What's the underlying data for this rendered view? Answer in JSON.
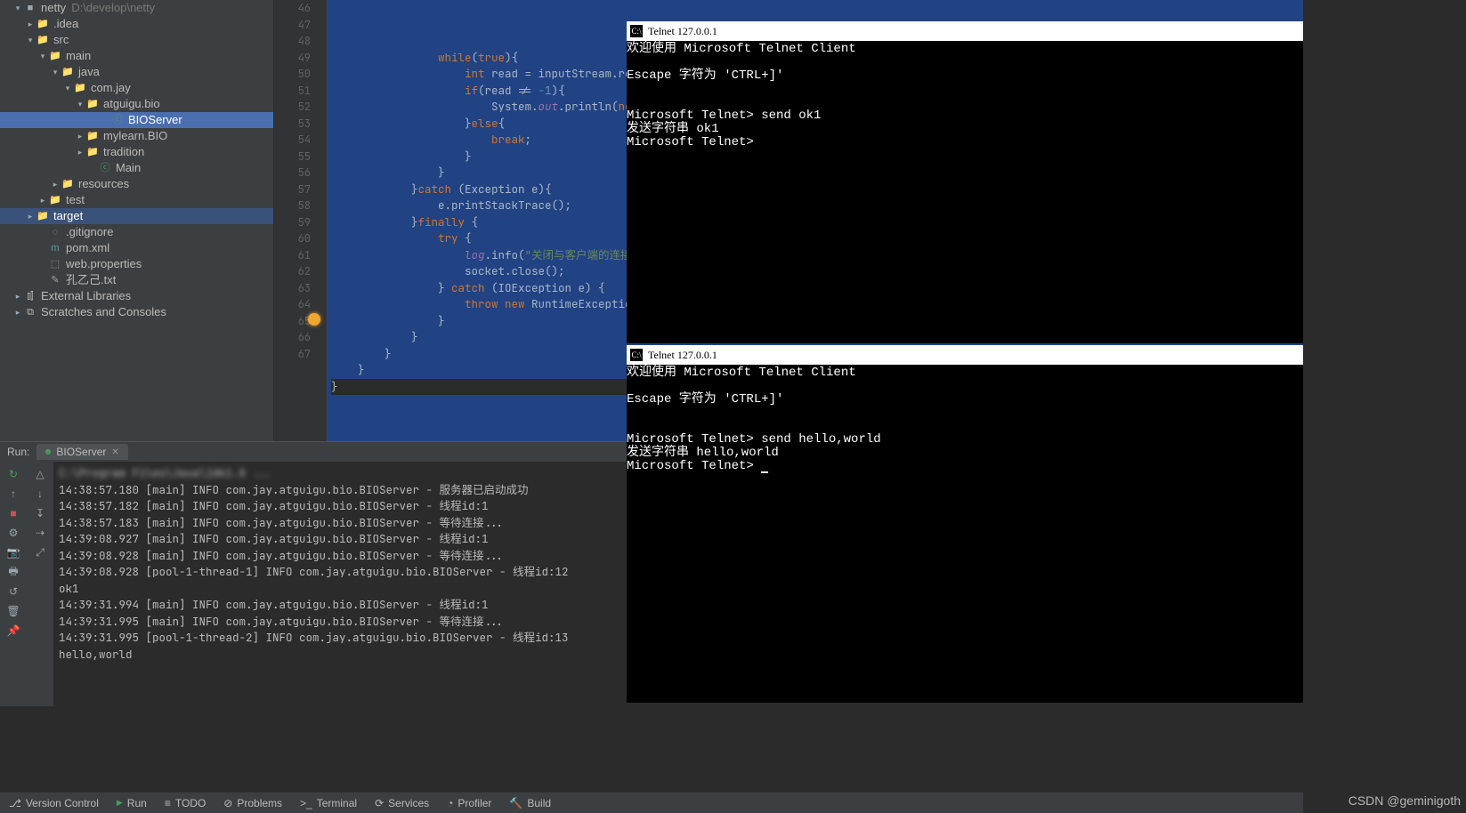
{
  "project": {
    "root": "netty",
    "root_hint": "D:\\develop\\netty",
    "tree": [
      {
        "indent": 14,
        "arrow": "v",
        "icon": "■",
        "label": "netty",
        "hint": "D:\\develop\\netty",
        "type": "root"
      },
      {
        "indent": 28,
        "arrow": ">",
        "icon": "📁",
        "label": ".idea",
        "type": "dir"
      },
      {
        "indent": 28,
        "arrow": "v",
        "icon": "📁",
        "label": "src",
        "type": "dir"
      },
      {
        "indent": 42,
        "arrow": "v",
        "icon": "📁",
        "label": "main",
        "type": "dir"
      },
      {
        "indent": 56,
        "arrow": "v",
        "icon": "📁",
        "label": "java",
        "type": "dir"
      },
      {
        "indent": 70,
        "arrow": "v",
        "icon": "📁",
        "label": "com.jay",
        "type": "pkg"
      },
      {
        "indent": 84,
        "arrow": "v",
        "icon": "📁",
        "label": "atguigu.bio",
        "type": "pkg"
      },
      {
        "indent": 112,
        "arrow": "",
        "icon": "ⓒ",
        "label": "BIOServer",
        "type": "class",
        "selected": true
      },
      {
        "indent": 84,
        "arrow": ">",
        "icon": "📁",
        "label": "mylearn.BIO",
        "type": "pkg"
      },
      {
        "indent": 84,
        "arrow": ">",
        "icon": "📁",
        "label": "tradition",
        "type": "pkg"
      },
      {
        "indent": 98,
        "arrow": "",
        "icon": "ⓒ",
        "label": "Main",
        "type": "class"
      },
      {
        "indent": 56,
        "arrow": ">",
        "icon": "📁",
        "label": "resources",
        "type": "dir"
      },
      {
        "indent": 42,
        "arrow": ">",
        "icon": "📁",
        "label": "test",
        "type": "dir"
      },
      {
        "indent": 28,
        "arrow": ">",
        "icon": "📁",
        "label": "target",
        "type": "dir-ex",
        "selected2": true
      },
      {
        "indent": 42,
        "arrow": "",
        "icon": "◌",
        "label": ".gitignore",
        "type": "file"
      },
      {
        "indent": 42,
        "arrow": "",
        "icon": "m",
        "label": "pom.xml",
        "type": "file-m"
      },
      {
        "indent": 42,
        "arrow": "",
        "icon": "⬚",
        "label": "web.properties",
        "type": "file"
      },
      {
        "indent": 42,
        "arrow": "",
        "icon": "✎",
        "label": "孔乙己.txt",
        "type": "file"
      }
    ],
    "extras": [
      {
        "label": "External Libraries"
      },
      {
        "label": "Scratches and Consoles"
      }
    ]
  },
  "gutter_lines": [
    "46",
    "47",
    "48",
    "49",
    "50",
    "51",
    "52",
    "53",
    "54",
    "55",
    "56",
    "57",
    "58",
    "59",
    "60",
    "61",
    "62",
    "63",
    "64",
    "65",
    "66",
    "67"
  ],
  "code_lines": [
    {
      "sel": true,
      "html": "                <span class='kw'>while</span>(<span class='kw'>true</span>){"
    },
    {
      "sel": true,
      "html": "                    <span class='kw'>int</span> read = inputStream.read(bytes);"
    },
    {
      "sel": true,
      "html": "                    <span class='kw'>if</span>(read != <span class='num'>-1</span>){"
    },
    {
      "sel": true,
      "html": "                        System.<span class='fld'>out</span>.println(<span class='kw'>new</span> Strin"
    },
    {
      "sel": true,
      "html": "                    }<span class='kw'>else</span>{"
    },
    {
      "sel": true,
      "html": "                        <span class='kw'>break</span>;"
    },
    {
      "sel": true,
      "html": "                    }"
    },
    {
      "sel": true,
      "html": "                }"
    },
    {
      "sel": true,
      "html": "            }<span class='kw'>catch</span> (Exception e){"
    },
    {
      "sel": true,
      "html": "                e.printStackTrace();"
    },
    {
      "sel": true,
      "html": "            }<span class='kw'>finally</span> {"
    },
    {
      "sel": true,
      "html": "                <span class='kw'>try</span> {"
    },
    {
      "sel": true,
      "html": "                    <span class='fld'>log</span>.info(<span class='str'>\"关闭与客户端的连接\"</span>);"
    },
    {
      "sel": true,
      "html": "                    socket.close();"
    },
    {
      "sel": true,
      "html": "                } <span class='kw'>catch</span> (IOException e) {"
    },
    {
      "sel": true,
      "html": "                    <span class='kw'>throw new</span> RuntimeException(e);"
    },
    {
      "sel": true,
      "html": "                }"
    },
    {
      "sel": true,
      "html": "            }"
    },
    {
      "sel": true,
      "html": "        }"
    },
    {
      "sel": true,
      "html": "    }"
    },
    {
      "sel": false,
      "html": "}"
    },
    {
      "sel": false,
      "html": ""
    }
  ],
  "run": {
    "label": "Run:",
    "tab": "BIOServer",
    "gutter_icons_left": [
      "↻",
      "↑",
      "■",
      "⚙",
      "📷",
      "🖶",
      "↺",
      "🗑",
      "📌"
    ],
    "gutter_icons_right": [
      "△",
      "↓",
      "↧",
      "⇢",
      "⤢",
      "",
      "",
      "",
      ""
    ],
    "blurred_first_line": "C:\\Program Files\\Java\\jdk1.8  ...",
    "lines": [
      "14:38:57.180 [main] INFO com.jay.atguigu.bio.BIOServer - 服务器已启动成功",
      "14:38:57.182 [main] INFO com.jay.atguigu.bio.BIOServer - 线程id:1",
      "14:38:57.183 [main] INFO com.jay.atguigu.bio.BIOServer - 等待连接...",
      "14:39:08.927 [main] INFO com.jay.atguigu.bio.BIOServer - 线程id:1",
      "14:39:08.928 [main] INFO com.jay.atguigu.bio.BIOServer - 等待连接...",
      "14:39:08.928 [pool-1-thread-1] INFO com.jay.atguigu.bio.BIOServer - 线程id:12",
      "ok1",
      "14:39:31.994 [main] INFO com.jay.atguigu.bio.BIOServer - 线程id:1",
      "14:39:31.995 [main] INFO com.jay.atguigu.bio.BIOServer - 等待连接...",
      "14:39:31.995 [pool-1-thread-2] INFO com.jay.atguigu.bio.BIOServer - 线程id:13",
      "hello,world"
    ]
  },
  "telnet1": {
    "title": "Telnet 127.0.0.1",
    "lines": [
      "欢迎使用 Microsoft Telnet Client",
      "",
      "Escape 字符为 'CTRL+]'",
      "",
      "",
      "Microsoft Telnet> send ok1",
      "发送字符串 ok1",
      "Microsoft Telnet>"
    ]
  },
  "telnet2": {
    "title": "Telnet 127.0.0.1",
    "lines": [
      "欢迎使用 Microsoft Telnet Client",
      "",
      "Escape 字符为 'CTRL+]'",
      "",
      "",
      "Microsoft Telnet> send hello,world",
      "发送字符串 hello,world",
      "Microsoft Telnet> "
    ],
    "cursor": true
  },
  "status": [
    {
      "icon": "⎇",
      "label": "Version Control"
    },
    {
      "icon": "▶",
      "label": "Run",
      "active": true
    },
    {
      "icon": "≡",
      "label": "TODO"
    },
    {
      "icon": "⊘",
      "label": "Problems"
    },
    {
      "icon": ">_",
      "label": "Terminal"
    },
    {
      "icon": "⟳",
      "label": "Services"
    },
    {
      "icon": "◔",
      "label": "Profiler"
    },
    {
      "icon": "🔨",
      "label": "Build"
    }
  ],
  "watermark": "CSDN @geminigoth"
}
